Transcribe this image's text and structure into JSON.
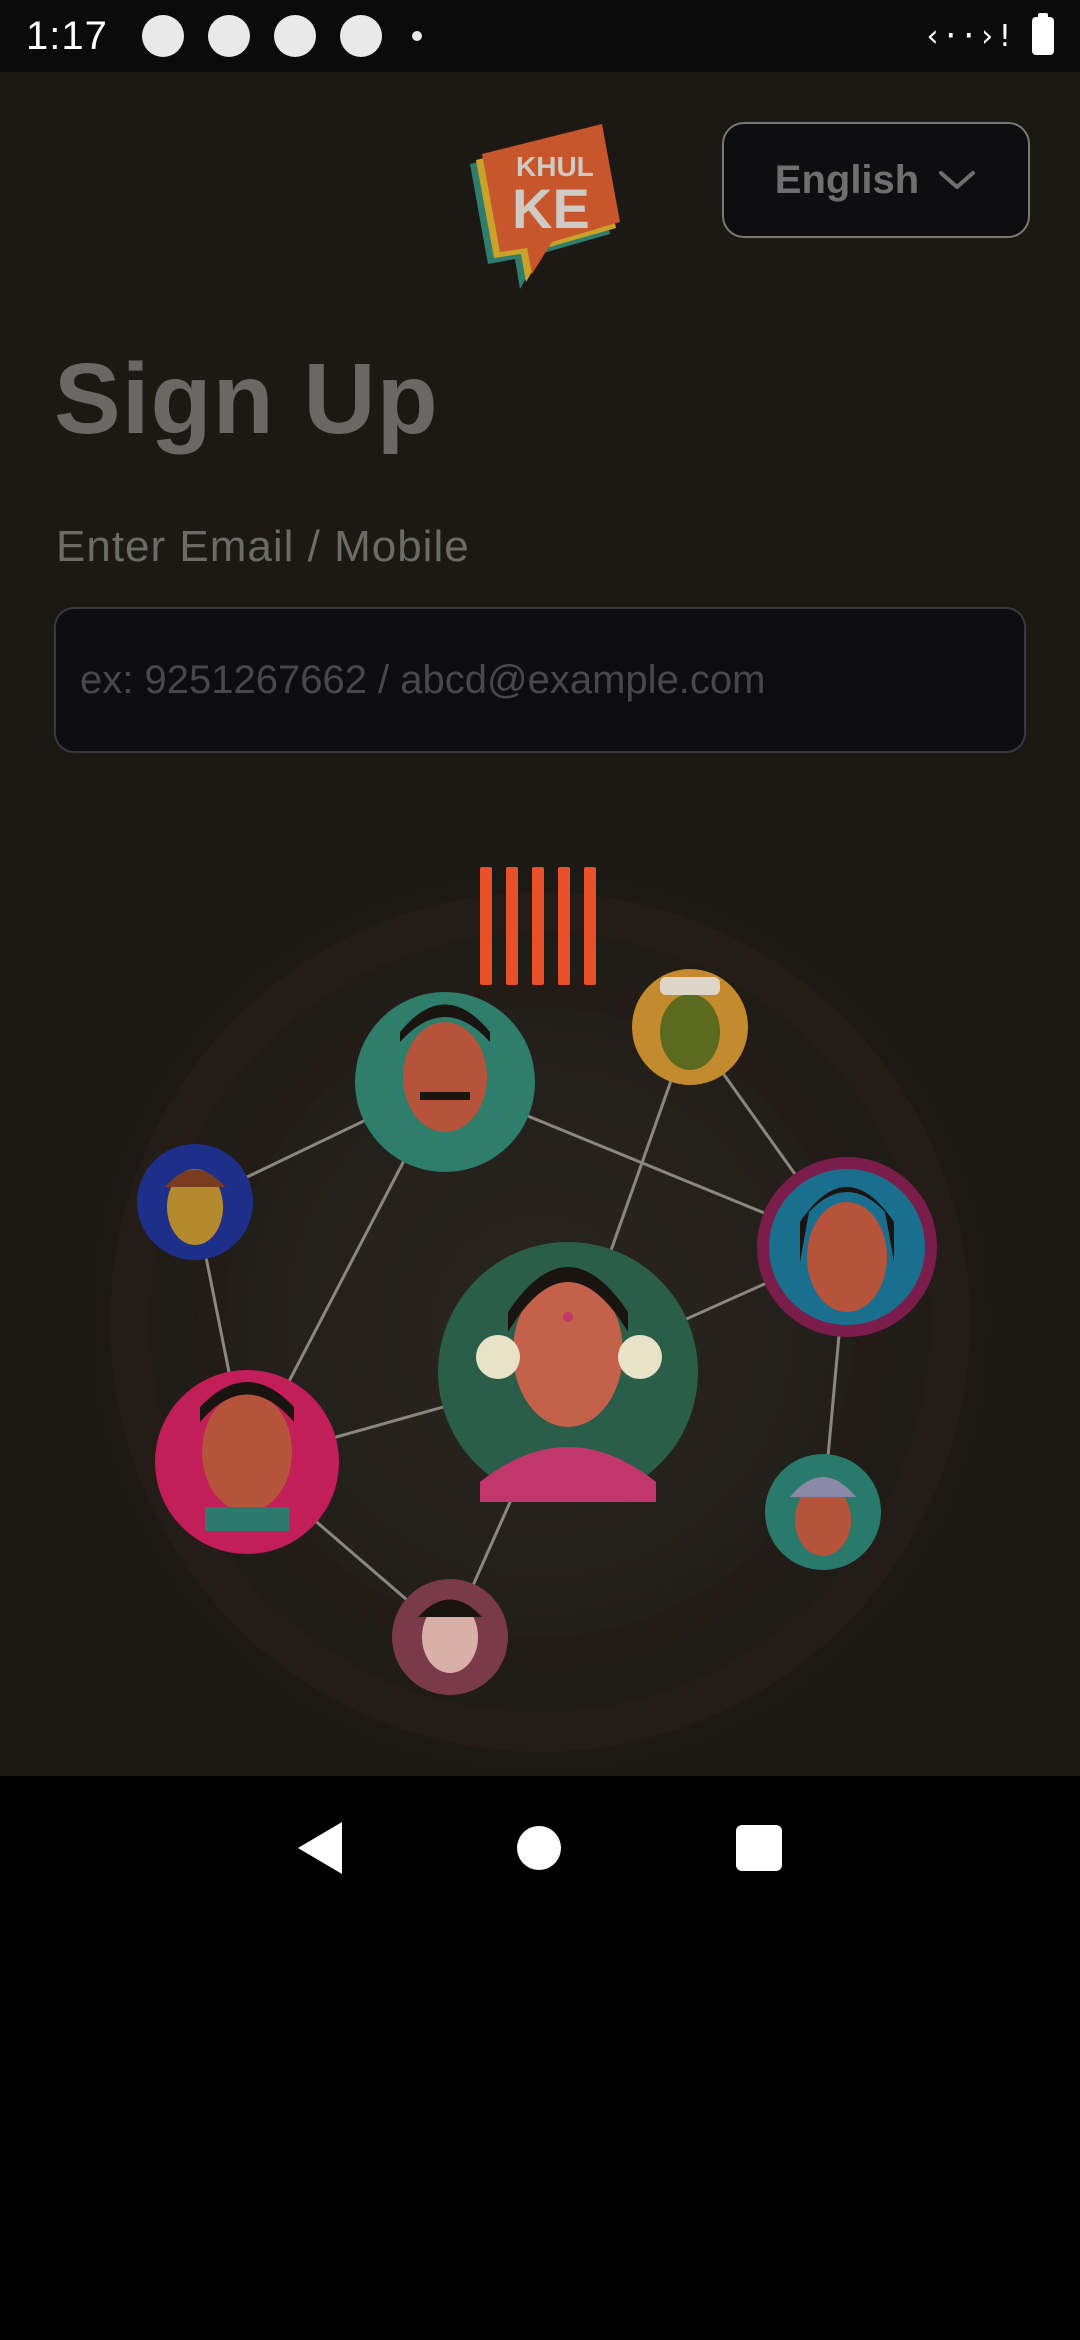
{
  "status_bar": {
    "time": "1:17",
    "signal_icon": "signal-icon",
    "battery_icon": "battery-icon"
  },
  "app": {
    "logo_text_top": "KHUL",
    "logo_text_bottom": "KE",
    "language_selector": {
      "selected": "English",
      "icon": "chevron-down-icon"
    },
    "title": "Sign Up",
    "email_field": {
      "label": "Enter Email / Mobile",
      "placeholder": "ex: 9251267662 / abcd@example.com",
      "value": ""
    },
    "loading_indicator": "loader-bars-icon",
    "colors": {
      "background": "#1c1914",
      "accent": "#e8502a",
      "input_background": "#0d0c10"
    }
  },
  "nav_bar": {
    "back": "back-icon",
    "home": "home-icon",
    "recents": "recents-icon"
  }
}
